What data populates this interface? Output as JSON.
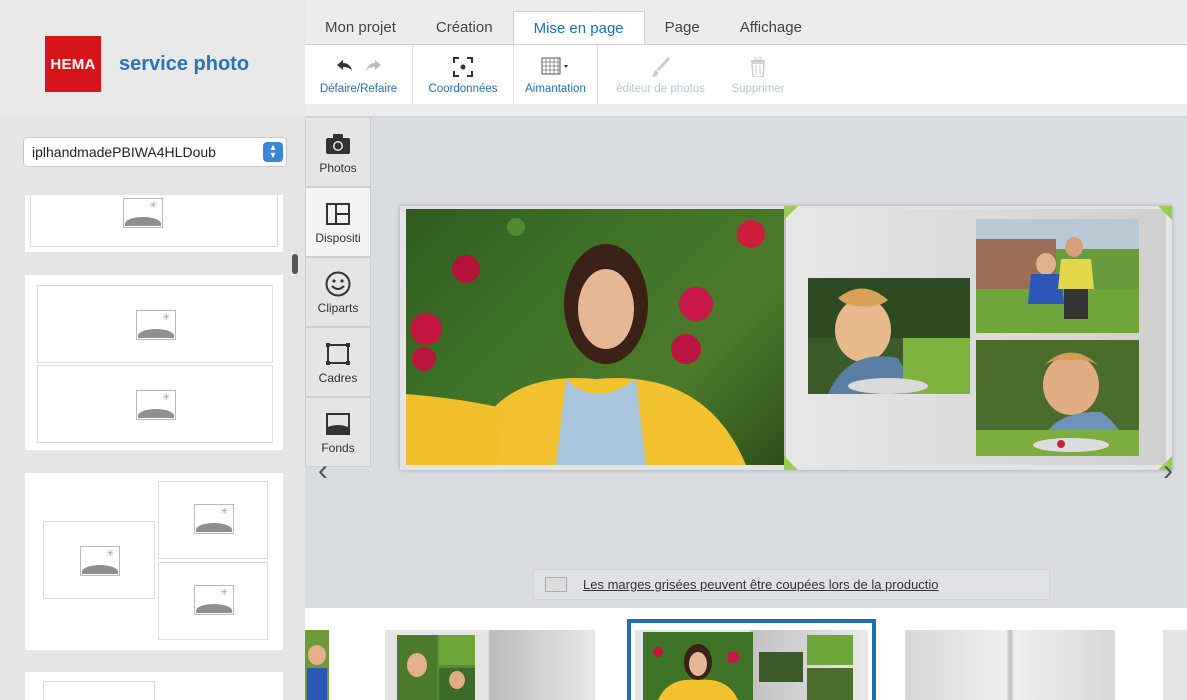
{
  "brand": {
    "logo_text": "HEMA",
    "service_name": "service photo",
    "logo_color": "#d7141a",
    "accent": "#1f6fb5"
  },
  "tabs": [
    {
      "label": "Mon projet",
      "active": false
    },
    {
      "label": "Création",
      "active": false
    },
    {
      "label": "Mise en page",
      "active": true
    },
    {
      "label": "Page",
      "active": false
    },
    {
      "label": "Affichage",
      "active": false
    }
  ],
  "toolbar": {
    "undo_redo": {
      "label": "Défaire/Refaire",
      "icons": [
        "undo-icon",
        "redo-icon"
      ]
    },
    "coordinates": {
      "label": "Coordonnées",
      "icon": "target-icon"
    },
    "snapping": {
      "label": "Aimantation",
      "icon": "grid-icon"
    },
    "photo_editor": {
      "label": "éditeur de photos",
      "icon": "brush-icon",
      "disabled": true
    },
    "delete": {
      "label": "Supprimer",
      "icon": "trash-icon",
      "disabled": true
    }
  },
  "left_panel": {
    "album_select_value": "iplhandmadePBIWA4HLDoub"
  },
  "side_tabs": [
    {
      "label": "Photos",
      "icon": "camera-icon"
    },
    {
      "label": "Dispositi",
      "icon": "layout-icon"
    },
    {
      "label": "Cliparts",
      "icon": "smiley-icon"
    },
    {
      "label": "Cadres",
      "icon": "frame-icon"
    },
    {
      "label": "Fonds",
      "icon": "background-icon"
    }
  ],
  "canvas": {
    "notice_text": "Les marges grisées peuvent être coupées lors de la productio",
    "prev_symbol": "‹",
    "next_symbol": "›"
  }
}
